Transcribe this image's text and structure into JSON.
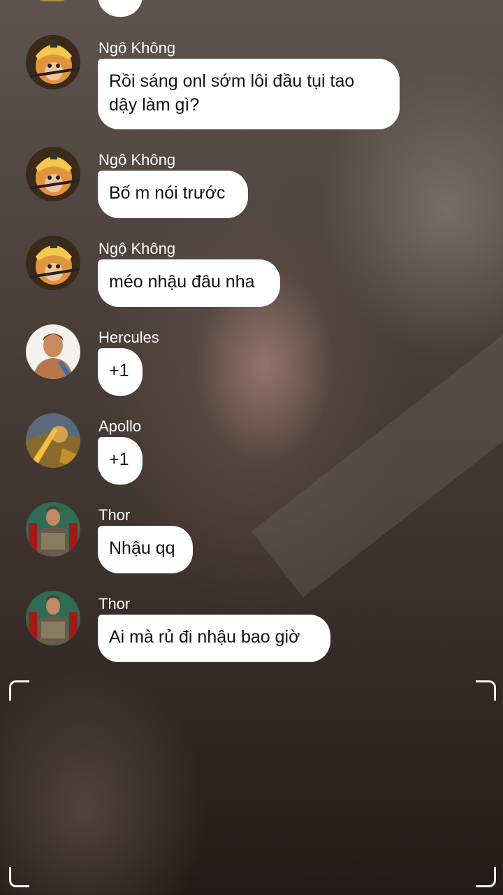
{
  "messages": [
    {
      "sender": "Ngộ Không",
      "text": "Rồi sáng onl sớm lôi đầu tụi tao\ndậy làm gì?",
      "avatar": "monkey-king-avatar"
    },
    {
      "sender": "Ngộ Không",
      "text": "Bố m nói trước",
      "avatar": "monkey-king-avatar"
    },
    {
      "sender": "Ngộ Không",
      "text": "méo nhậu đâu nha",
      "avatar": "monkey-king-avatar"
    },
    {
      "sender": "Hercules",
      "text": "+1",
      "avatar": "hercules-avatar"
    },
    {
      "sender": "Apollo",
      "text": "+1",
      "avatar": "apollo-avatar"
    },
    {
      "sender": "Thor",
      "text": "Nhậu qq",
      "avatar": "thor-avatar"
    },
    {
      "sender": "Thor",
      "text": "Ai mà rủ đi nhậu bao giờ",
      "avatar": "thor-avatar"
    }
  ],
  "colors": {
    "bubble": "#ffffff",
    "sender_text": "#ffffff",
    "message_text": "#111111"
  }
}
